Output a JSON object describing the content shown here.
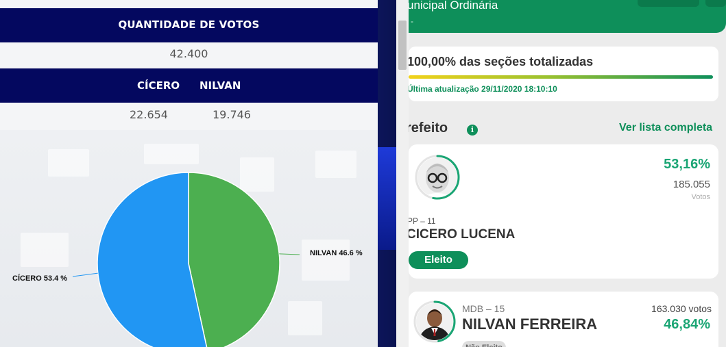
{
  "left": {
    "votes_header": "QUANTIDADE DE VOTOS",
    "total_votes": "42.400",
    "candidates_header": [
      "CÍCERO",
      "NILVAN"
    ],
    "candidates_votes": [
      "22.654",
      "19.746"
    ]
  },
  "chart_data": {
    "type": "pie",
    "title": "",
    "slices": [
      {
        "label": "NILVAN",
        "value": 46.6,
        "color": "#4caf50"
      },
      {
        "label": "CÍCERO",
        "value": 53.4,
        "color": "#2196f3"
      }
    ],
    "data_labels": [
      "NILVAN 46.6 %",
      "CÍCERO 53.4 %"
    ]
  },
  "right": {
    "header_title": "unicipal Ordinária",
    "header_sub": "-",
    "status": {
      "percent_text": "100,00% das seções totalizadas",
      "progress": 1.0,
      "updated_text": "Última atualização 29/11/2020 18:10:10"
    },
    "section": {
      "title": "refeito",
      "info_icon": "i",
      "full_list_link": "Ver lista completa"
    },
    "candidate1": {
      "party": "PP – 11",
      "name": "CICERO LUCENA",
      "percent": "53,16%",
      "votes": "185.055",
      "votes_label": "Votos",
      "status": "Eleito",
      "share": 0.5316
    },
    "candidate2": {
      "party": "MDB – 15",
      "name": "NILVAN FERREIRA",
      "votes": "163.030 votos",
      "percent": "46,84%",
      "status": "Não Eleito",
      "share": 0.4684
    }
  },
  "colors": {
    "navy": "#04085f",
    "green": "#0e8f5a",
    "accent_green": "#1aa574",
    "pie_blue": "#2196f3",
    "pie_green": "#4caf50"
  }
}
